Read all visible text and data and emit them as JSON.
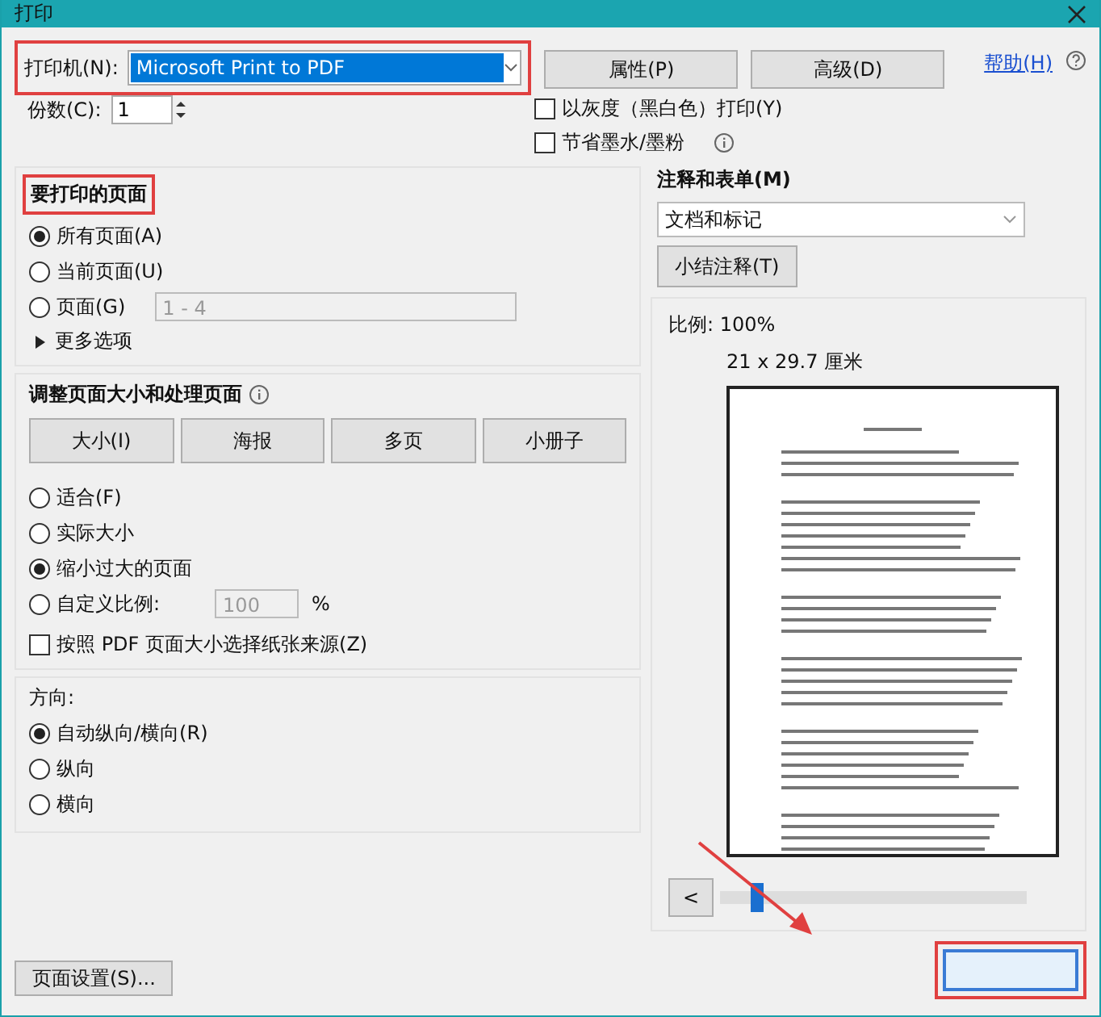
{
  "window": {
    "title": "打印"
  },
  "printer": {
    "label": "打印机(N):",
    "value": "Microsoft Print to PDF",
    "highlighted": true
  },
  "top_buttons": [
    "属性(P)",
    "高级(D)"
  ],
  "help": "帮助(H)",
  "copies": {
    "label": "份数(C):",
    "value": "1"
  },
  "print_options": [
    {
      "label": "以灰度（黑白色）打印(Y)",
      "checked": false,
      "info": false
    },
    {
      "label": "节省墨水/墨粉",
      "checked": false,
      "info": true
    }
  ],
  "pages": {
    "title": "要打印的页面",
    "highlighted": true,
    "options": [
      {
        "label": "所有页面(A)",
        "selected": true
      },
      {
        "label": "当前页面(U)",
        "selected": false
      },
      {
        "label": "页面(G)",
        "selected": false,
        "range": "1 - 4"
      }
    ],
    "more": "更多选项"
  },
  "sizing": {
    "title": "调整页面大小和处理页面",
    "buttons": [
      "大小(I)",
      "海报",
      "多页",
      "小册子"
    ],
    "options": [
      {
        "label": "适合(F)",
        "selected": false
      },
      {
        "label": "实际大小",
        "selected": false
      },
      {
        "label": "缩小过大的页面",
        "selected": true
      },
      {
        "label": "自定义比例:",
        "selected": false,
        "scale": "100",
        "unit": "%"
      }
    ],
    "pdf_source": {
      "label": "按照 PDF 页面大小选择纸张来源(Z)",
      "checked": false
    }
  },
  "orientation": {
    "title": "方向:",
    "options": [
      {
        "label": "自动纵向/横向(R)",
        "selected": true
      },
      {
        "label": "纵向",
        "selected": false
      },
      {
        "label": "横向",
        "selected": false
      }
    ]
  },
  "page_setup": "页面设置(S)...",
  "annotations": {
    "title": "注释和表单(M)",
    "value": "文档和标记",
    "summary_button": "小结注释(T)"
  },
  "preview": {
    "scale": "比例: 100%",
    "size": "21 x 29.7 厘米",
    "prev": "<",
    "slider": {
      "level": 0.1
    }
  },
  "action_button": {
    "highlighted": true
  }
}
